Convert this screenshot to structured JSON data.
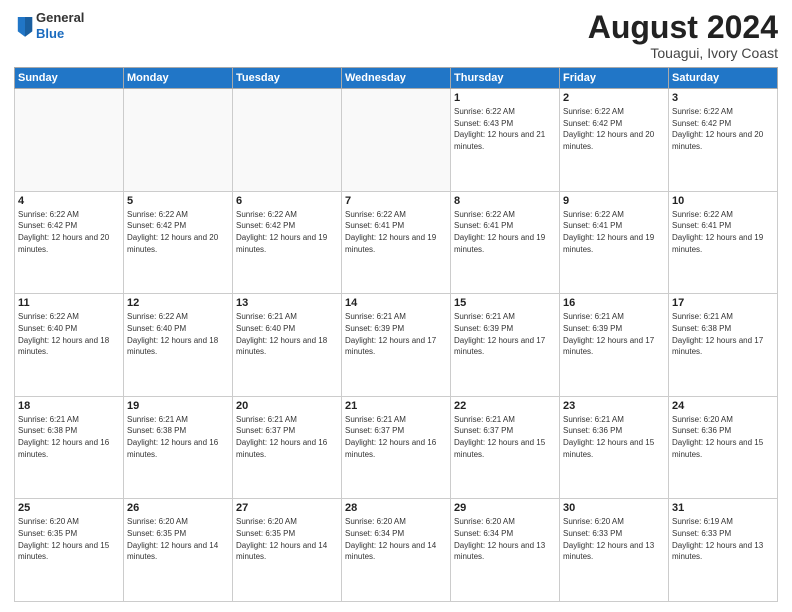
{
  "logo": {
    "line1": "General",
    "line2": "Blue"
  },
  "header": {
    "month": "August 2024",
    "location": "Touagui, Ivory Coast"
  },
  "weekdays": [
    "Sunday",
    "Monday",
    "Tuesday",
    "Wednesday",
    "Thursday",
    "Friday",
    "Saturday"
  ],
  "weeks": [
    [
      {
        "day": "",
        "info": ""
      },
      {
        "day": "",
        "info": ""
      },
      {
        "day": "",
        "info": ""
      },
      {
        "day": "",
        "info": ""
      },
      {
        "day": "1",
        "info": "Sunrise: 6:22 AM\nSunset: 6:43 PM\nDaylight: 12 hours and 21 minutes."
      },
      {
        "day": "2",
        "info": "Sunrise: 6:22 AM\nSunset: 6:42 PM\nDaylight: 12 hours and 20 minutes."
      },
      {
        "day": "3",
        "info": "Sunrise: 6:22 AM\nSunset: 6:42 PM\nDaylight: 12 hours and 20 minutes."
      }
    ],
    [
      {
        "day": "4",
        "info": "Sunrise: 6:22 AM\nSunset: 6:42 PM\nDaylight: 12 hours and 20 minutes."
      },
      {
        "day": "5",
        "info": "Sunrise: 6:22 AM\nSunset: 6:42 PM\nDaylight: 12 hours and 20 minutes."
      },
      {
        "day": "6",
        "info": "Sunrise: 6:22 AM\nSunset: 6:42 PM\nDaylight: 12 hours and 19 minutes."
      },
      {
        "day": "7",
        "info": "Sunrise: 6:22 AM\nSunset: 6:41 PM\nDaylight: 12 hours and 19 minutes."
      },
      {
        "day": "8",
        "info": "Sunrise: 6:22 AM\nSunset: 6:41 PM\nDaylight: 12 hours and 19 minutes."
      },
      {
        "day": "9",
        "info": "Sunrise: 6:22 AM\nSunset: 6:41 PM\nDaylight: 12 hours and 19 minutes."
      },
      {
        "day": "10",
        "info": "Sunrise: 6:22 AM\nSunset: 6:41 PM\nDaylight: 12 hours and 19 minutes."
      }
    ],
    [
      {
        "day": "11",
        "info": "Sunrise: 6:22 AM\nSunset: 6:40 PM\nDaylight: 12 hours and 18 minutes."
      },
      {
        "day": "12",
        "info": "Sunrise: 6:22 AM\nSunset: 6:40 PM\nDaylight: 12 hours and 18 minutes."
      },
      {
        "day": "13",
        "info": "Sunrise: 6:21 AM\nSunset: 6:40 PM\nDaylight: 12 hours and 18 minutes."
      },
      {
        "day": "14",
        "info": "Sunrise: 6:21 AM\nSunset: 6:39 PM\nDaylight: 12 hours and 17 minutes."
      },
      {
        "day": "15",
        "info": "Sunrise: 6:21 AM\nSunset: 6:39 PM\nDaylight: 12 hours and 17 minutes."
      },
      {
        "day": "16",
        "info": "Sunrise: 6:21 AM\nSunset: 6:39 PM\nDaylight: 12 hours and 17 minutes."
      },
      {
        "day": "17",
        "info": "Sunrise: 6:21 AM\nSunset: 6:38 PM\nDaylight: 12 hours and 17 minutes."
      }
    ],
    [
      {
        "day": "18",
        "info": "Sunrise: 6:21 AM\nSunset: 6:38 PM\nDaylight: 12 hours and 16 minutes."
      },
      {
        "day": "19",
        "info": "Sunrise: 6:21 AM\nSunset: 6:38 PM\nDaylight: 12 hours and 16 minutes."
      },
      {
        "day": "20",
        "info": "Sunrise: 6:21 AM\nSunset: 6:37 PM\nDaylight: 12 hours and 16 minutes."
      },
      {
        "day": "21",
        "info": "Sunrise: 6:21 AM\nSunset: 6:37 PM\nDaylight: 12 hours and 16 minutes."
      },
      {
        "day": "22",
        "info": "Sunrise: 6:21 AM\nSunset: 6:37 PM\nDaylight: 12 hours and 15 minutes."
      },
      {
        "day": "23",
        "info": "Sunrise: 6:21 AM\nSunset: 6:36 PM\nDaylight: 12 hours and 15 minutes."
      },
      {
        "day": "24",
        "info": "Sunrise: 6:20 AM\nSunset: 6:36 PM\nDaylight: 12 hours and 15 minutes."
      }
    ],
    [
      {
        "day": "25",
        "info": "Sunrise: 6:20 AM\nSunset: 6:35 PM\nDaylight: 12 hours and 15 minutes."
      },
      {
        "day": "26",
        "info": "Sunrise: 6:20 AM\nSunset: 6:35 PM\nDaylight: 12 hours and 14 minutes."
      },
      {
        "day": "27",
        "info": "Sunrise: 6:20 AM\nSunset: 6:35 PM\nDaylight: 12 hours and 14 minutes."
      },
      {
        "day": "28",
        "info": "Sunrise: 6:20 AM\nSunset: 6:34 PM\nDaylight: 12 hours and 14 minutes."
      },
      {
        "day": "29",
        "info": "Sunrise: 6:20 AM\nSunset: 6:34 PM\nDaylight: 12 hours and 13 minutes."
      },
      {
        "day": "30",
        "info": "Sunrise: 6:20 AM\nSunset: 6:33 PM\nDaylight: 12 hours and 13 minutes."
      },
      {
        "day": "31",
        "info": "Sunrise: 6:19 AM\nSunset: 6:33 PM\nDaylight: 12 hours and 13 minutes."
      }
    ]
  ]
}
